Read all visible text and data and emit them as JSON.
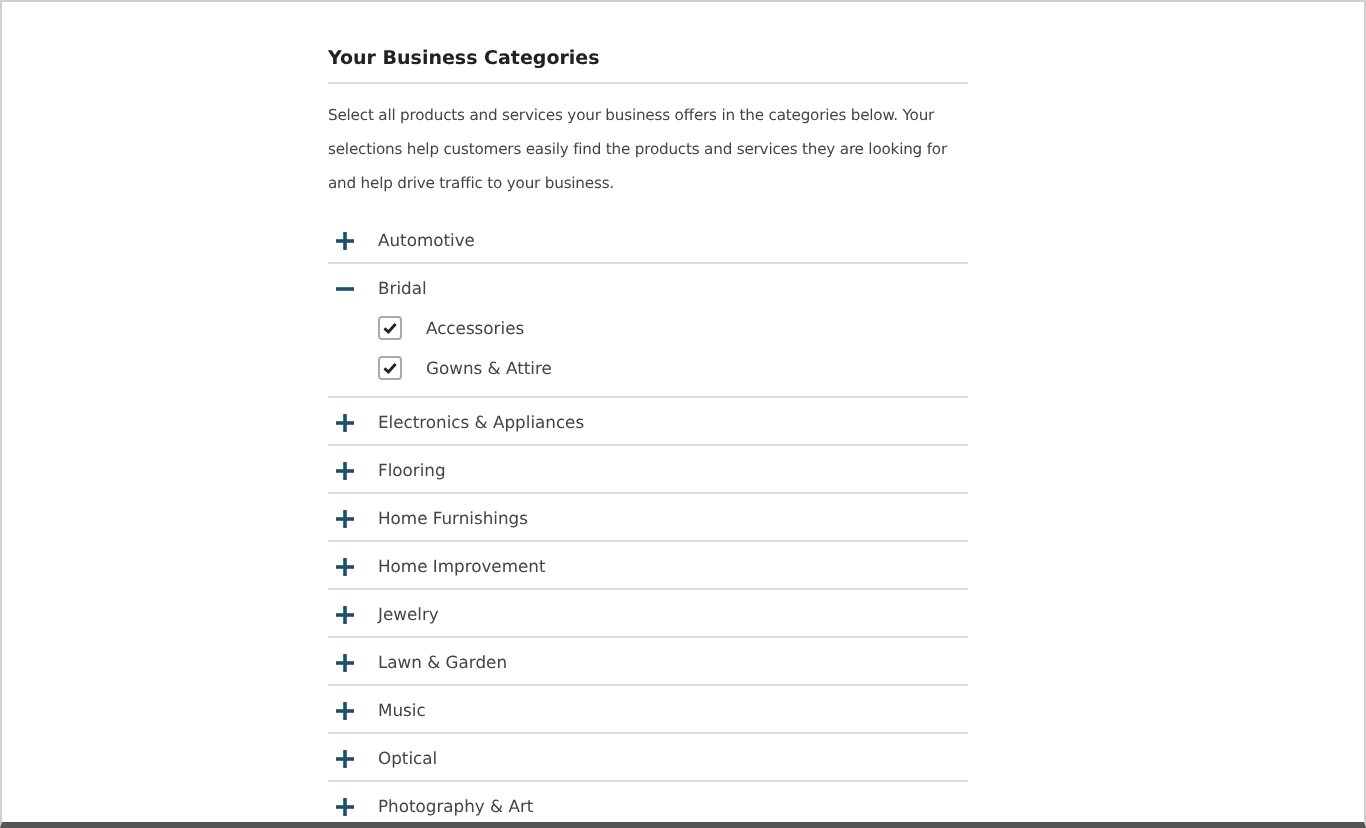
{
  "heading": "Your Business Categories",
  "description": "Select all products and services your business offers in the categories below. Your selections help customers easily find the products and services they are looking for and help drive traffic to your business.",
  "categories": [
    {
      "label": "Automotive",
      "expanded": false
    },
    {
      "label": "Bridal",
      "expanded": true,
      "children": [
        {
          "label": "Accessories",
          "checked": true
        },
        {
          "label": "Gowns & Attire",
          "checked": true
        }
      ]
    },
    {
      "label": "Electronics & Appliances",
      "expanded": false
    },
    {
      "label": "Flooring",
      "expanded": false
    },
    {
      "label": "Home Furnishings",
      "expanded": false
    },
    {
      "label": "Home Improvement",
      "expanded": false
    },
    {
      "label": "Jewelry",
      "expanded": false
    },
    {
      "label": "Lawn & Garden",
      "expanded": false
    },
    {
      "label": "Music",
      "expanded": false
    },
    {
      "label": "Optical",
      "expanded": false
    },
    {
      "label": "Photography & Art",
      "expanded": false
    }
  ]
}
